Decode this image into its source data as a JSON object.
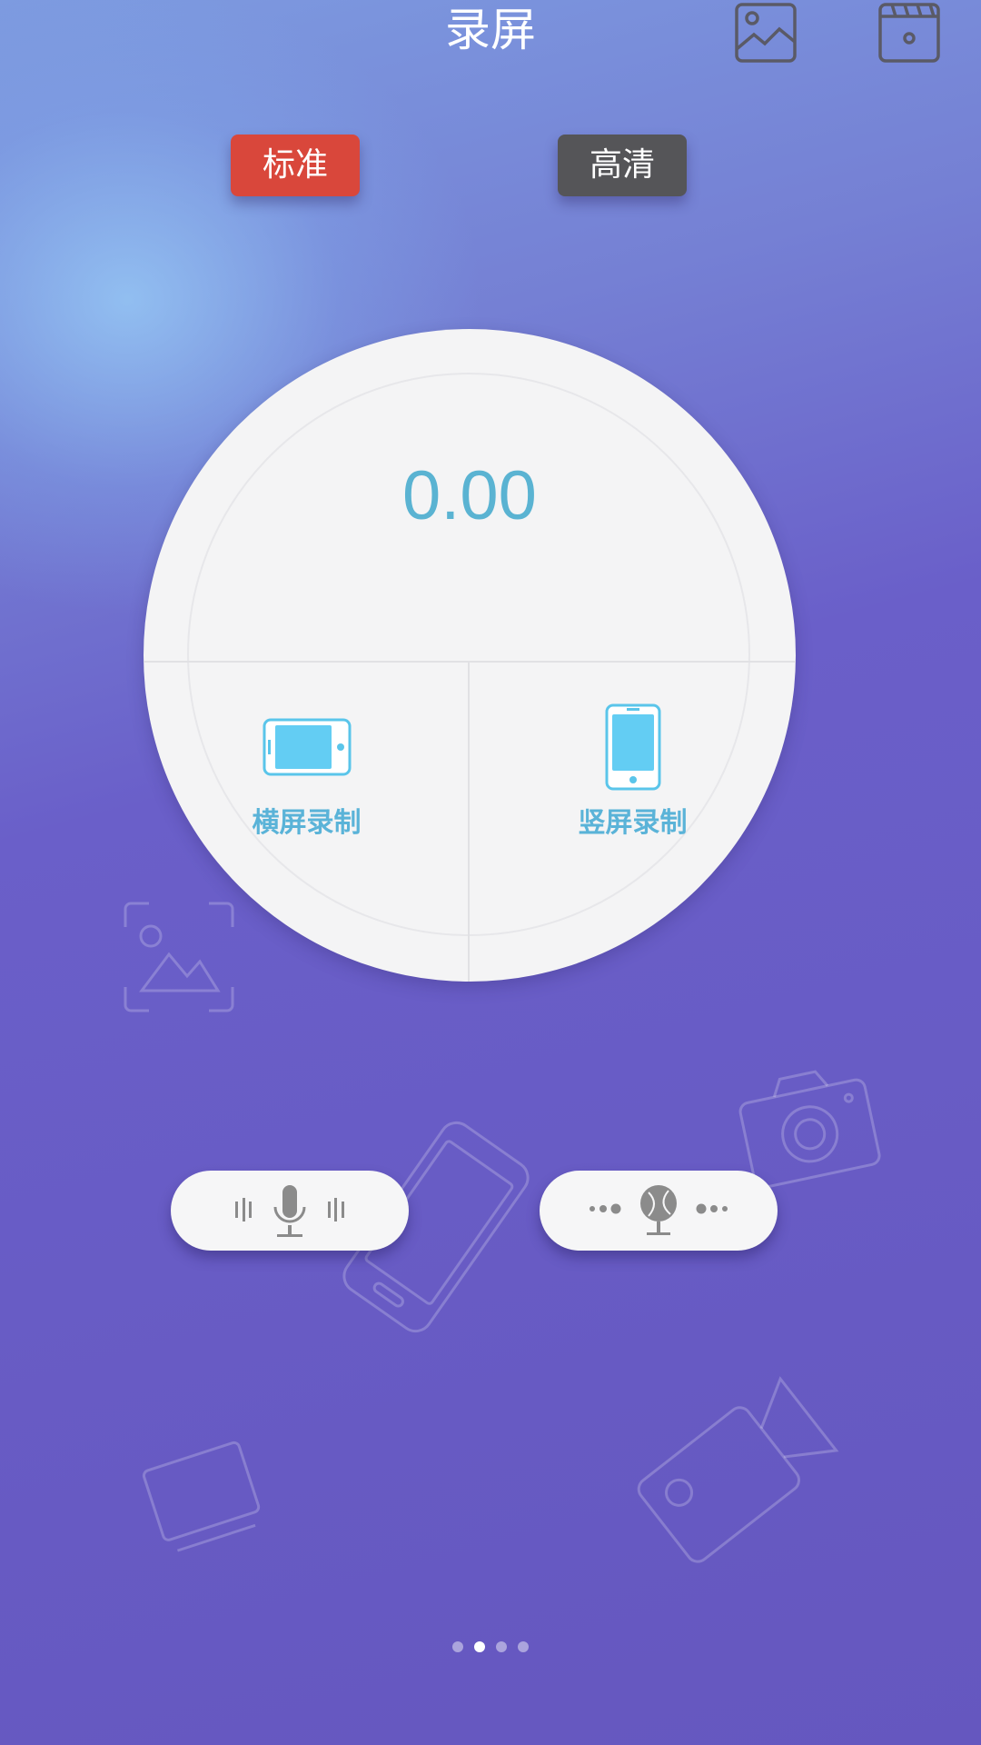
{
  "header": {
    "title": "录屏"
  },
  "quality": {
    "standard_label": "标准",
    "hd_label": "高清",
    "selected": "标准"
  },
  "dial": {
    "timer": "0.00",
    "landscape_label": "横屏录制",
    "portrait_label": "竖屏录制"
  },
  "controls": {
    "mic_icon": "microphone-icon",
    "remote_icon": "remote-mic-icon"
  },
  "pager": {
    "count": 4,
    "active_index": 1
  },
  "colors": {
    "standard_active": "#d9473b",
    "hd_inactive": "#555558",
    "accent": "#5ab3d2",
    "background_top": "#7d9be0",
    "background_bottom": "#6557bf"
  }
}
